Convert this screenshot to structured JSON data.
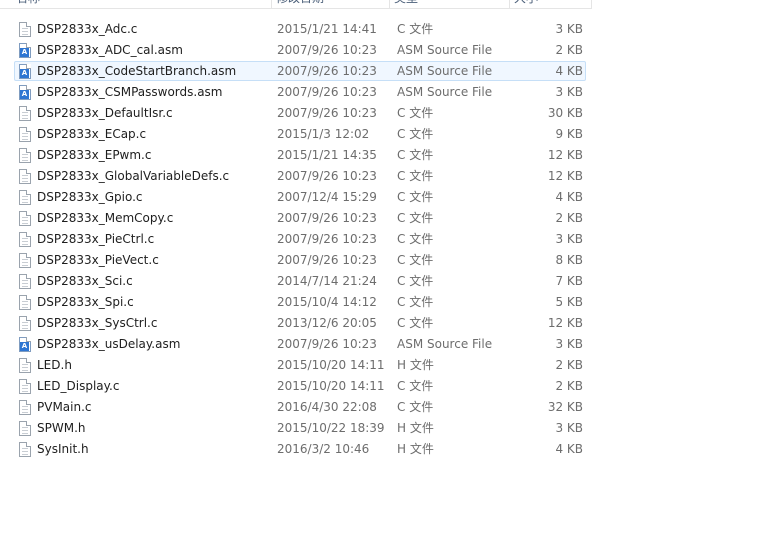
{
  "header": {
    "name": "名称",
    "date": "修改日期",
    "type": "类型",
    "size": "大小"
  },
  "files": [
    {
      "name": "DSP2833x_Adc.c",
      "date": "2015/1/21 14:41",
      "type": "C 文件",
      "size": "3 KB",
      "icon": "c-file-icon",
      "selected": false
    },
    {
      "name": "DSP2833x_ADC_cal.asm",
      "date": "2007/9/26 10:23",
      "type": "ASM Source File",
      "size": "2 KB",
      "icon": "asm-file-icon",
      "selected": false
    },
    {
      "name": "DSP2833x_CodeStartBranch.asm",
      "date": "2007/9/26 10:23",
      "type": "ASM Source File",
      "size": "4 KB",
      "icon": "asm-file-icon",
      "selected": true
    },
    {
      "name": "DSP2833x_CSMPasswords.asm",
      "date": "2007/9/26 10:23",
      "type": "ASM Source File",
      "size": "3 KB",
      "icon": "asm-file-icon",
      "selected": false
    },
    {
      "name": "DSP2833x_DefaultIsr.c",
      "date": "2007/9/26 10:23",
      "type": "C 文件",
      "size": "30 KB",
      "icon": "c-file-icon",
      "selected": false
    },
    {
      "name": "DSP2833x_ECap.c",
      "date": "2015/1/3 12:02",
      "type": "C 文件",
      "size": "9 KB",
      "icon": "c-file-icon",
      "selected": false
    },
    {
      "name": "DSP2833x_EPwm.c",
      "date": "2015/1/21 14:35",
      "type": "C 文件",
      "size": "12 KB",
      "icon": "c-file-icon",
      "selected": false
    },
    {
      "name": "DSP2833x_GlobalVariableDefs.c",
      "date": "2007/9/26 10:23",
      "type": "C 文件",
      "size": "12 KB",
      "icon": "c-file-icon",
      "selected": false
    },
    {
      "name": "DSP2833x_Gpio.c",
      "date": "2007/12/4 15:29",
      "type": "C 文件",
      "size": "4 KB",
      "icon": "c-file-icon",
      "selected": false
    },
    {
      "name": "DSP2833x_MemCopy.c",
      "date": "2007/9/26 10:23",
      "type": "C 文件",
      "size": "2 KB",
      "icon": "c-file-icon",
      "selected": false
    },
    {
      "name": "DSP2833x_PieCtrl.c",
      "date": "2007/9/26 10:23",
      "type": "C 文件",
      "size": "3 KB",
      "icon": "c-file-icon",
      "selected": false
    },
    {
      "name": "DSP2833x_PieVect.c",
      "date": "2007/9/26 10:23",
      "type": "C 文件",
      "size": "8 KB",
      "icon": "c-file-icon",
      "selected": false
    },
    {
      "name": "DSP2833x_Sci.c",
      "date": "2014/7/14 21:24",
      "type": "C 文件",
      "size": "7 KB",
      "icon": "c-file-icon",
      "selected": false
    },
    {
      "name": "DSP2833x_Spi.c",
      "date": "2015/10/4 14:12",
      "type": "C 文件",
      "size": "5 KB",
      "icon": "c-file-icon",
      "selected": false
    },
    {
      "name": "DSP2833x_SysCtrl.c",
      "date": "2013/12/6 20:05",
      "type": "C 文件",
      "size": "12 KB",
      "icon": "c-file-icon",
      "selected": false
    },
    {
      "name": "DSP2833x_usDelay.asm",
      "date": "2007/9/26 10:23",
      "type": "ASM Source File",
      "size": "3 KB",
      "icon": "asm-file-icon",
      "selected": false
    },
    {
      "name": "LED.h",
      "date": "2015/10/20 14:11",
      "type": "H 文件",
      "size": "2 KB",
      "icon": "h-file-icon",
      "selected": false
    },
    {
      "name": "LED_Display.c",
      "date": "2015/10/20 14:11",
      "type": "C 文件",
      "size": "2 KB",
      "icon": "c-file-icon",
      "selected": false
    },
    {
      "name": "PVMain.c",
      "date": "2016/4/30 22:08",
      "type": "C 文件",
      "size": "32 KB",
      "icon": "c-file-icon",
      "selected": false
    },
    {
      "name": "SPWM.h",
      "date": "2015/10/22 18:39",
      "type": "H 文件",
      "size": "3 KB",
      "icon": "h-file-icon",
      "selected": false
    },
    {
      "name": "SysInit.h",
      "date": "2016/3/2 10:46",
      "type": "H 文件",
      "size": "4 KB",
      "icon": "h-file-icon",
      "selected": false
    }
  ]
}
